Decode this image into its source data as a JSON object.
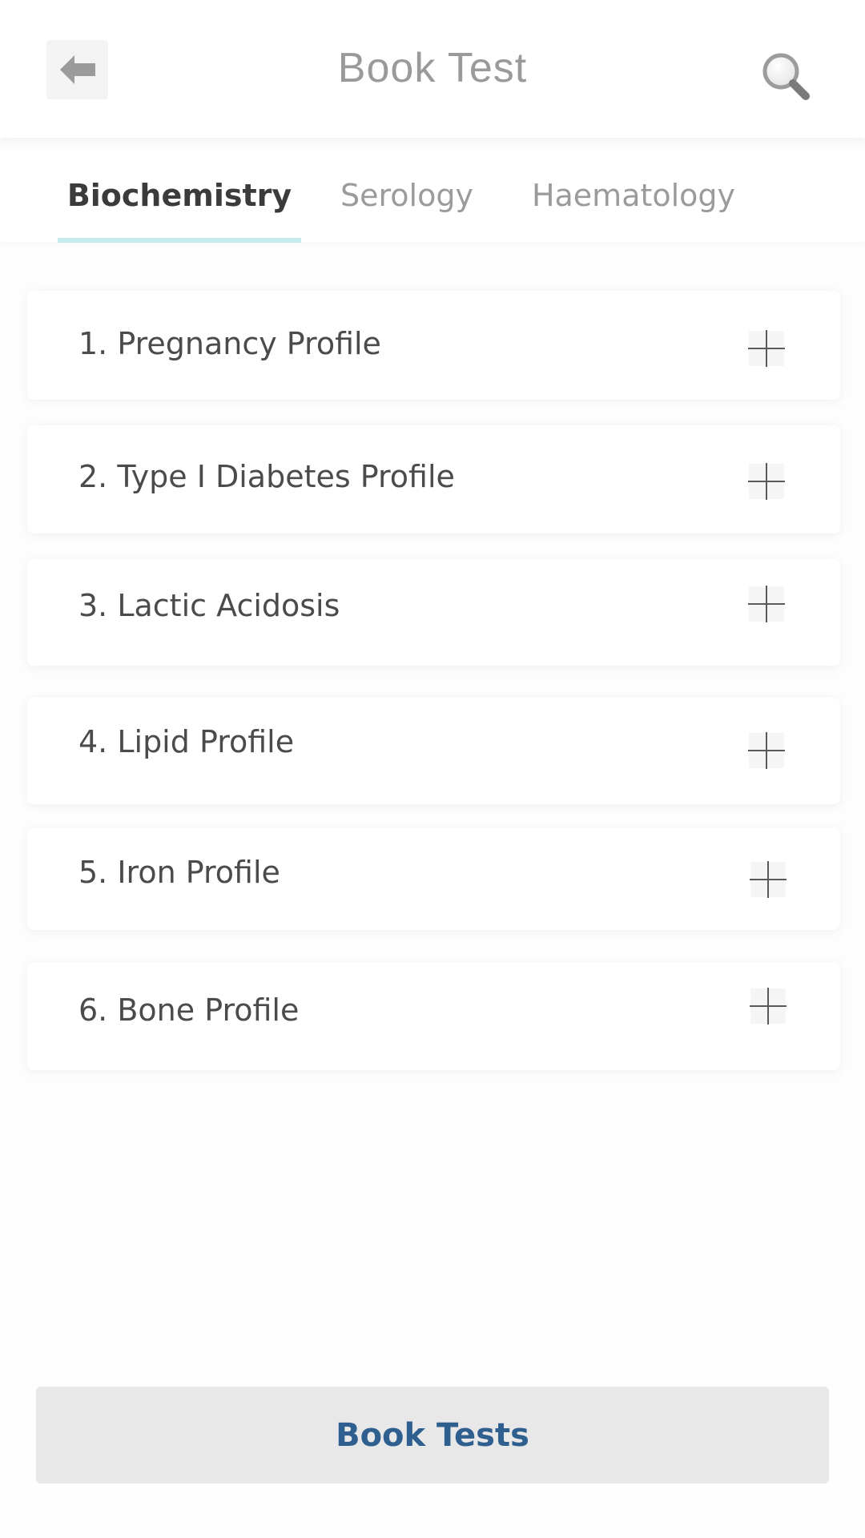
{
  "header": {
    "title": "Book Test",
    "back_icon": "arrow-left-icon",
    "search_icon": "search-icon"
  },
  "tabs": [
    {
      "label": "Biochemistry",
      "active": true
    },
    {
      "label": "Serology",
      "active": false
    },
    {
      "label": "Haematology",
      "active": false
    }
  ],
  "tests": [
    {
      "number": "1.",
      "name": "Pregnancy Profile",
      "label": "1.  Pregnancy Profile"
    },
    {
      "number": "2.",
      "name": "Type I Diabetes Profile",
      "label": "2.  Type I Diabetes Profile"
    },
    {
      "number": "3.",
      "name": "Lactic Acidosis",
      "label": "3.  Lactic Acidosis"
    },
    {
      "number": "4.",
      "name": "Lipid Profile",
      "label": "4.  Lipid Profile"
    },
    {
      "number": "5.",
      "name": "Iron Profile",
      "label": "5.  Iron Profile"
    },
    {
      "number": "6.",
      "name": "Bone Profile",
      "label": "6.  Bone Profile"
    }
  ],
  "footer": {
    "book_label": "Book Tests"
  },
  "colors": {
    "accent_text": "#2f5f8f",
    "tab_indicator": "#c6ecee",
    "button_bg": "#e8e8e8"
  }
}
